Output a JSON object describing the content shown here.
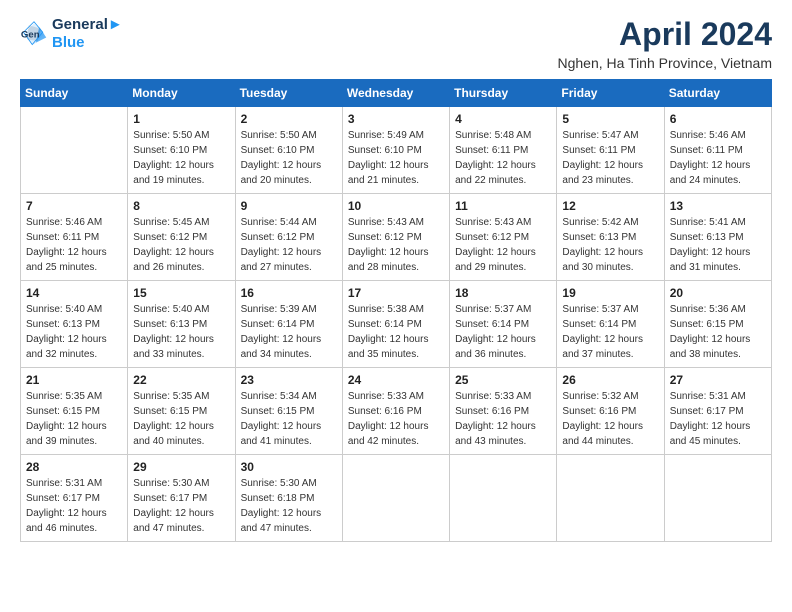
{
  "logo": {
    "line1": "General",
    "line2": "Blue"
  },
  "title": {
    "month_year": "April 2024",
    "location": "Nghen, Ha Tinh Province, Vietnam"
  },
  "weekdays": [
    "Sunday",
    "Monday",
    "Tuesday",
    "Wednesday",
    "Thursday",
    "Friday",
    "Saturday"
  ],
  "weeks": [
    [
      {
        "day": "",
        "sunrise": "",
        "sunset": "",
        "daylight": ""
      },
      {
        "day": "1",
        "sunrise": "Sunrise: 5:50 AM",
        "sunset": "Sunset: 6:10 PM",
        "daylight": "Daylight: 12 hours and 19 minutes."
      },
      {
        "day": "2",
        "sunrise": "Sunrise: 5:50 AM",
        "sunset": "Sunset: 6:10 PM",
        "daylight": "Daylight: 12 hours and 20 minutes."
      },
      {
        "day": "3",
        "sunrise": "Sunrise: 5:49 AM",
        "sunset": "Sunset: 6:10 PM",
        "daylight": "Daylight: 12 hours and 21 minutes."
      },
      {
        "day": "4",
        "sunrise": "Sunrise: 5:48 AM",
        "sunset": "Sunset: 6:11 PM",
        "daylight": "Daylight: 12 hours and 22 minutes."
      },
      {
        "day": "5",
        "sunrise": "Sunrise: 5:47 AM",
        "sunset": "Sunset: 6:11 PM",
        "daylight": "Daylight: 12 hours and 23 minutes."
      },
      {
        "day": "6",
        "sunrise": "Sunrise: 5:46 AM",
        "sunset": "Sunset: 6:11 PM",
        "daylight": "Daylight: 12 hours and 24 minutes."
      }
    ],
    [
      {
        "day": "7",
        "sunrise": "Sunrise: 5:46 AM",
        "sunset": "Sunset: 6:11 PM",
        "daylight": "Daylight: 12 hours and 25 minutes."
      },
      {
        "day": "8",
        "sunrise": "Sunrise: 5:45 AM",
        "sunset": "Sunset: 6:12 PM",
        "daylight": "Daylight: 12 hours and 26 minutes."
      },
      {
        "day": "9",
        "sunrise": "Sunrise: 5:44 AM",
        "sunset": "Sunset: 6:12 PM",
        "daylight": "Daylight: 12 hours and 27 minutes."
      },
      {
        "day": "10",
        "sunrise": "Sunrise: 5:43 AM",
        "sunset": "Sunset: 6:12 PM",
        "daylight": "Daylight: 12 hours and 28 minutes."
      },
      {
        "day": "11",
        "sunrise": "Sunrise: 5:43 AM",
        "sunset": "Sunset: 6:12 PM",
        "daylight": "Daylight: 12 hours and 29 minutes."
      },
      {
        "day": "12",
        "sunrise": "Sunrise: 5:42 AM",
        "sunset": "Sunset: 6:13 PM",
        "daylight": "Daylight: 12 hours and 30 minutes."
      },
      {
        "day": "13",
        "sunrise": "Sunrise: 5:41 AM",
        "sunset": "Sunset: 6:13 PM",
        "daylight": "Daylight: 12 hours and 31 minutes."
      }
    ],
    [
      {
        "day": "14",
        "sunrise": "Sunrise: 5:40 AM",
        "sunset": "Sunset: 6:13 PM",
        "daylight": "Daylight: 12 hours and 32 minutes."
      },
      {
        "day": "15",
        "sunrise": "Sunrise: 5:40 AM",
        "sunset": "Sunset: 6:13 PM",
        "daylight": "Daylight: 12 hours and 33 minutes."
      },
      {
        "day": "16",
        "sunrise": "Sunrise: 5:39 AM",
        "sunset": "Sunset: 6:14 PM",
        "daylight": "Daylight: 12 hours and 34 minutes."
      },
      {
        "day": "17",
        "sunrise": "Sunrise: 5:38 AM",
        "sunset": "Sunset: 6:14 PM",
        "daylight": "Daylight: 12 hours and 35 minutes."
      },
      {
        "day": "18",
        "sunrise": "Sunrise: 5:37 AM",
        "sunset": "Sunset: 6:14 PM",
        "daylight": "Daylight: 12 hours and 36 minutes."
      },
      {
        "day": "19",
        "sunrise": "Sunrise: 5:37 AM",
        "sunset": "Sunset: 6:14 PM",
        "daylight": "Daylight: 12 hours and 37 minutes."
      },
      {
        "day": "20",
        "sunrise": "Sunrise: 5:36 AM",
        "sunset": "Sunset: 6:15 PM",
        "daylight": "Daylight: 12 hours and 38 minutes."
      }
    ],
    [
      {
        "day": "21",
        "sunrise": "Sunrise: 5:35 AM",
        "sunset": "Sunset: 6:15 PM",
        "daylight": "Daylight: 12 hours and 39 minutes."
      },
      {
        "day": "22",
        "sunrise": "Sunrise: 5:35 AM",
        "sunset": "Sunset: 6:15 PM",
        "daylight": "Daylight: 12 hours and 40 minutes."
      },
      {
        "day": "23",
        "sunrise": "Sunrise: 5:34 AM",
        "sunset": "Sunset: 6:15 PM",
        "daylight": "Daylight: 12 hours and 41 minutes."
      },
      {
        "day": "24",
        "sunrise": "Sunrise: 5:33 AM",
        "sunset": "Sunset: 6:16 PM",
        "daylight": "Daylight: 12 hours and 42 minutes."
      },
      {
        "day": "25",
        "sunrise": "Sunrise: 5:33 AM",
        "sunset": "Sunset: 6:16 PM",
        "daylight": "Daylight: 12 hours and 43 minutes."
      },
      {
        "day": "26",
        "sunrise": "Sunrise: 5:32 AM",
        "sunset": "Sunset: 6:16 PM",
        "daylight": "Daylight: 12 hours and 44 minutes."
      },
      {
        "day": "27",
        "sunrise": "Sunrise: 5:31 AM",
        "sunset": "Sunset: 6:17 PM",
        "daylight": "Daylight: 12 hours and 45 minutes."
      }
    ],
    [
      {
        "day": "28",
        "sunrise": "Sunrise: 5:31 AM",
        "sunset": "Sunset: 6:17 PM",
        "daylight": "Daylight: 12 hours and 46 minutes."
      },
      {
        "day": "29",
        "sunrise": "Sunrise: 5:30 AM",
        "sunset": "Sunset: 6:17 PM",
        "daylight": "Daylight: 12 hours and 47 minutes."
      },
      {
        "day": "30",
        "sunrise": "Sunrise: 5:30 AM",
        "sunset": "Sunset: 6:18 PM",
        "daylight": "Daylight: 12 hours and 47 minutes."
      },
      {
        "day": "",
        "sunrise": "",
        "sunset": "",
        "daylight": ""
      },
      {
        "day": "",
        "sunrise": "",
        "sunset": "",
        "daylight": ""
      },
      {
        "day": "",
        "sunrise": "",
        "sunset": "",
        "daylight": ""
      },
      {
        "day": "",
        "sunrise": "",
        "sunset": "",
        "daylight": ""
      }
    ]
  ]
}
